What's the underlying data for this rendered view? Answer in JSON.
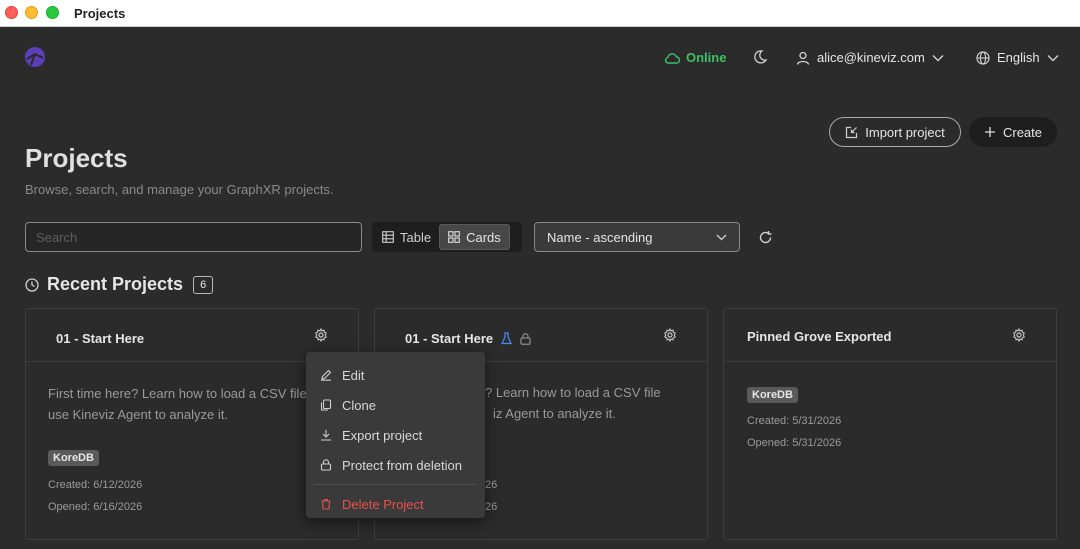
{
  "window": {
    "title": "Projects"
  },
  "nav": {
    "status": "Online",
    "user_email": "alice@kineviz.com",
    "language": "English"
  },
  "header": {
    "import_label": "Import project",
    "create_label": "Create",
    "title": "Projects",
    "subtitle": "Browse, search, and manage your GraphXR projects."
  },
  "toolbar": {
    "search_placeholder": "Search",
    "view_table": "Table",
    "view_cards": "Cards",
    "active_view": "Cards",
    "sort": "Name - ascending"
  },
  "recent": {
    "title": "Recent Projects",
    "count": "6"
  },
  "cards": [
    {
      "title": "01 - Start Here",
      "description": "First time here? Learn how to load a CSV file and use Kineviz Agent to analyze it.",
      "tag": "KoreDB",
      "created": "Created: 6/12/2026",
      "opened": "Opened: 6/16/2026"
    },
    {
      "title": "01 - Start Here",
      "description_visible": "? Learn how to load a CSV file",
      "description_visible_2": "iz Agent to analyze it.",
      "created_visible": "26",
      "opened_visible": "26"
    },
    {
      "title": "Pinned Grove Exported",
      "tag": "KoreDB",
      "created": "Created: 5/31/2026",
      "opened": "Opened: 5/31/2026"
    }
  ],
  "context_menu": {
    "items": [
      "Edit",
      "Clone",
      "Export project",
      "Protect from deletion"
    ],
    "delete_label": "Delete Project"
  },
  "colors": {
    "background": "#2b2b2b",
    "online": "#3fbf66",
    "danger": "#e5534b",
    "flask": "#4a8cff"
  }
}
